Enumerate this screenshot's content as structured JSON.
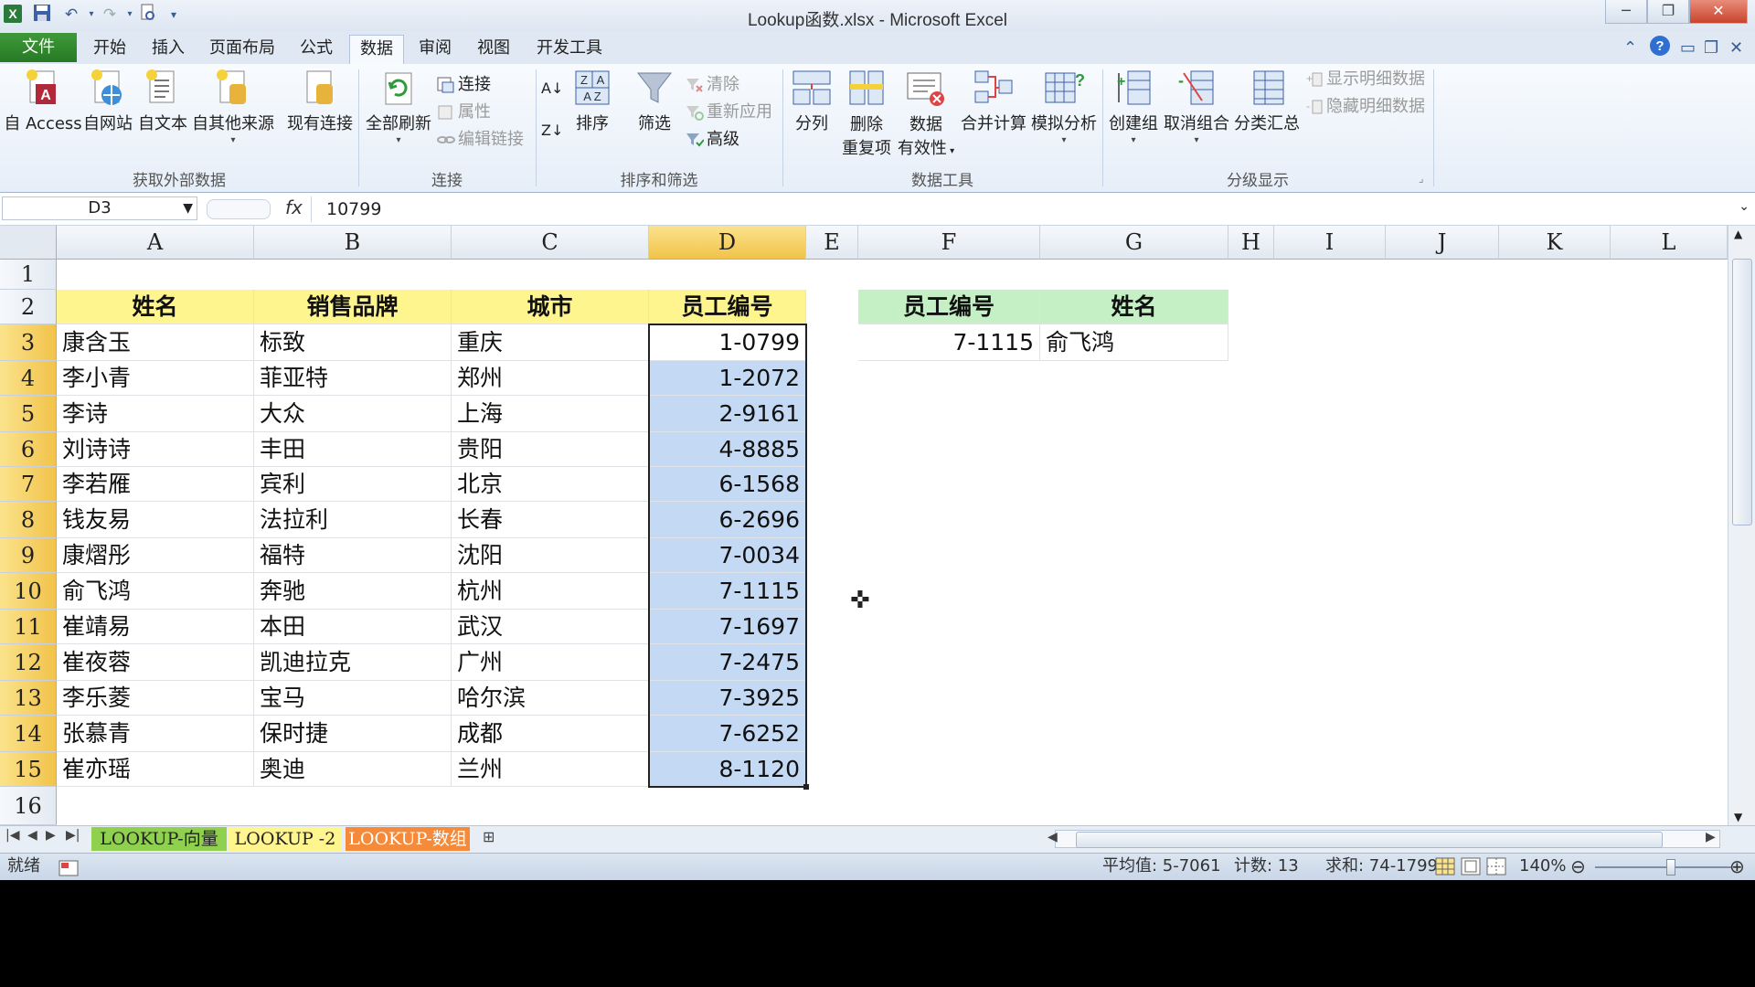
{
  "window": {
    "title": "Lookup函数.xlsx - Microsoft Excel",
    "quick_access": [
      "save-icon",
      "undo-icon",
      "redo-icon",
      "print-preview-icon",
      "customize-icon"
    ]
  },
  "tabs": [
    {
      "label": "文件",
      "state": "file"
    },
    {
      "label": "开始",
      "state": ""
    },
    {
      "label": "插入",
      "state": ""
    },
    {
      "label": "页面布局",
      "state": ""
    },
    {
      "label": "公式",
      "state": ""
    },
    {
      "label": "数据",
      "state": "active"
    },
    {
      "label": "审阅",
      "state": ""
    },
    {
      "label": "视图",
      "state": ""
    },
    {
      "label": "开发工具",
      "state": ""
    }
  ],
  "ribbon": {
    "groups": {
      "external": "获取外部数据",
      "connections": "连接",
      "sort_filter": "排序和筛选",
      "data_tools": "数据工具",
      "outline": "分级显示"
    },
    "buttons": {
      "access": "自 Access",
      "web": "自网站",
      "text": "自文本",
      "other": "自其他来源",
      "existing": "现有连接",
      "refresh_all": "全部刷新",
      "connections": "连接",
      "properties": "属性",
      "edit_links": "编辑链接",
      "sort": "排序",
      "filter": "筛选",
      "clear": "清除",
      "reapply": "重新应用",
      "advanced": "高级",
      "split": "分列",
      "remove_dup_1": "删除",
      "remove_dup_2": "重复项",
      "validation_1": "数据",
      "validation_2": "有效性",
      "consolidate": "合并计算",
      "whatif": "模拟分析",
      "group": "创建组",
      "ungroup": "取消组合",
      "subtotal": "分类汇总",
      "show_detail": "显示明细数据",
      "hide_detail": "隐藏明细数据"
    }
  },
  "formula_bar": {
    "name_box": "D3",
    "fx": "fx",
    "value": "10799"
  },
  "columns": [
    "A",
    "B",
    "C",
    "D",
    "E",
    "F",
    "G",
    "H",
    "I",
    "J",
    "K",
    "L"
  ],
  "rows": [
    "1",
    "2",
    "3",
    "4",
    "5",
    "6",
    "7",
    "8",
    "9",
    "10",
    "11",
    "12",
    "13",
    "14",
    "15",
    "16"
  ],
  "table": {
    "headers": [
      "姓名",
      "销售品牌",
      "城市",
      "员工编号"
    ],
    "rows": [
      [
        "康含玉",
        "标致",
        "重庆",
        "1-0799"
      ],
      [
        "李小青",
        "菲亚特",
        "郑州",
        "1-2072"
      ],
      [
        "李诗",
        "大众",
        "上海",
        "2-9161"
      ],
      [
        "刘诗诗",
        "丰田",
        "贵阳",
        "4-8885"
      ],
      [
        "李若雁",
        "宾利",
        "北京",
        "6-1568"
      ],
      [
        "钱友易",
        "法拉利",
        "长春",
        "6-2696"
      ],
      [
        "康熠彤",
        "福特",
        "沈阳",
        "7-0034"
      ],
      [
        "俞飞鸿",
        "奔驰",
        "杭州",
        "7-1115"
      ],
      [
        "崔靖易",
        "本田",
        "武汉",
        "7-1697"
      ],
      [
        "崔夜蓉",
        "凯迪拉克",
        "广州",
        "7-2475"
      ],
      [
        "李乐菱",
        "宝马",
        "哈尔滨",
        "7-3925"
      ],
      [
        "张慕青",
        "保时捷",
        "成都",
        "7-6252"
      ],
      [
        "崔亦瑶",
        "奥迪",
        "兰州",
        "8-1120"
      ]
    ]
  },
  "lookup": {
    "headers": [
      "员工编号",
      "姓名"
    ],
    "values": [
      "7-1115",
      "俞飞鸿"
    ]
  },
  "sheets": [
    {
      "label": "LOOKUP-向量",
      "color": "#8fd14f"
    },
    {
      "label": "LOOKUP -2",
      "color": "#fff58f"
    },
    {
      "label": "LOOKUP-数组",
      "color": "#f58a3a"
    }
  ],
  "status": {
    "ready": "就绪",
    "average": "平均值: 5-7061",
    "count": "计数: 13",
    "sum": "求和: 74-1799",
    "zoom": "140%",
    "zoom_level": 0.55
  },
  "colors": {
    "header_yellow": "#fff58f",
    "header_green": "#c5f0c5",
    "selection_blue": "#c4daf4",
    "active_header": "#f1c34a"
  }
}
